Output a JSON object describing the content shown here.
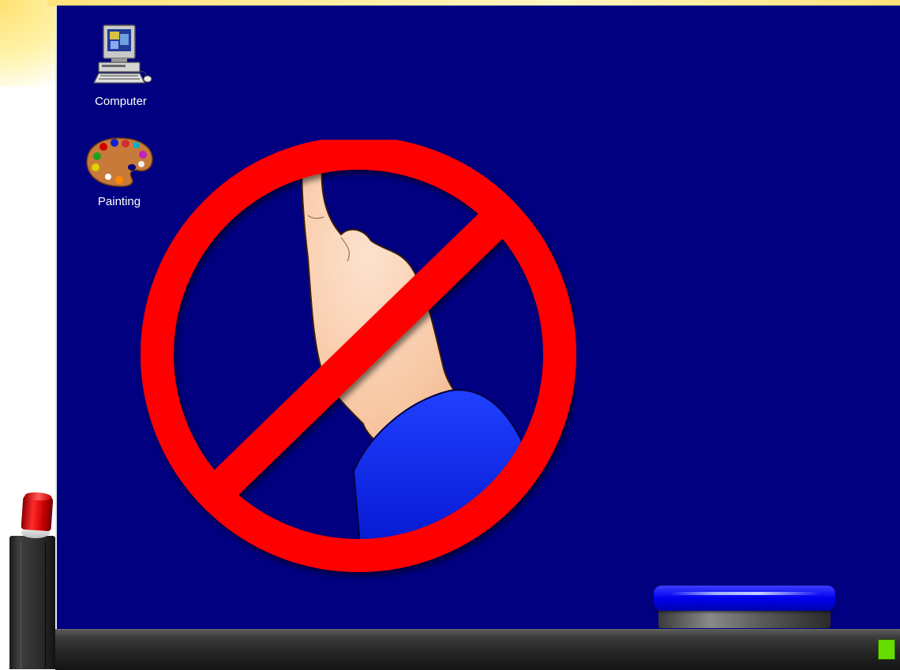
{
  "desktop": {
    "background_color": "#000080",
    "icons": [
      {
        "label": "Computer",
        "icon": "computer-icon"
      },
      {
        "label": "Painting",
        "icon": "palette-icon"
      }
    ]
  },
  "overlay": {
    "icon": "no-touch-icon",
    "ring_color": "#ff0000"
  },
  "taskbar": {
    "indicator_color": "#66dd00"
  },
  "controls": {
    "big_button_color": "#0000ee",
    "side_cap_color": "#ff0000"
  }
}
